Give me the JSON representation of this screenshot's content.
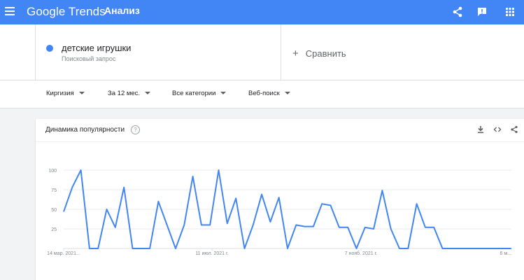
{
  "header": {
    "logo": "Google Trends",
    "section": "Анализ",
    "menu_icon": "menu-icon",
    "icons": [
      "share-icon",
      "feedback-icon",
      "apps-grid-icon"
    ]
  },
  "search_term": {
    "label": "детские игрушки",
    "sublabel": "Поисковый запрос",
    "color": "#4285f4"
  },
  "compare": {
    "plus": "+",
    "label": "Сравнить"
  },
  "filters": [
    {
      "label": "Киргизия"
    },
    {
      "label": "За 12 мес."
    },
    {
      "label": "Все категории"
    },
    {
      "label": "Веб-поиск"
    }
  ],
  "card": {
    "title": "Динамика популярности",
    "help": "?",
    "icons": [
      "download-icon",
      "embed-icon",
      "share-icon"
    ]
  },
  "chart_data": {
    "type": "line",
    "ylim": [
      0,
      100
    ],
    "yticks": [
      "100",
      "75",
      "50",
      "25"
    ],
    "xtick_labels": [
      "14 мар. 2021...",
      "11 июл. 2021 г.",
      "7 нояб. 2021 г.",
      "6 м..."
    ],
    "grid": true,
    "series": [
      {
        "color": "#4285f4",
        "values": [
          47,
          78,
          100,
          0,
          0,
          50,
          27,
          78,
          0,
          0,
          0,
          60,
          30,
          0,
          30,
          92,
          30,
          30,
          100,
          32,
          64,
          0,
          30,
          69,
          34,
          65,
          0,
          30,
          28,
          28,
          57,
          55,
          27,
          27,
          0,
          27,
          25,
          74,
          25,
          0,
          0,
          57,
          27,
          27,
          0,
          0,
          0,
          0,
          0,
          0,
          0,
          0,
          0
        ]
      }
    ]
  }
}
